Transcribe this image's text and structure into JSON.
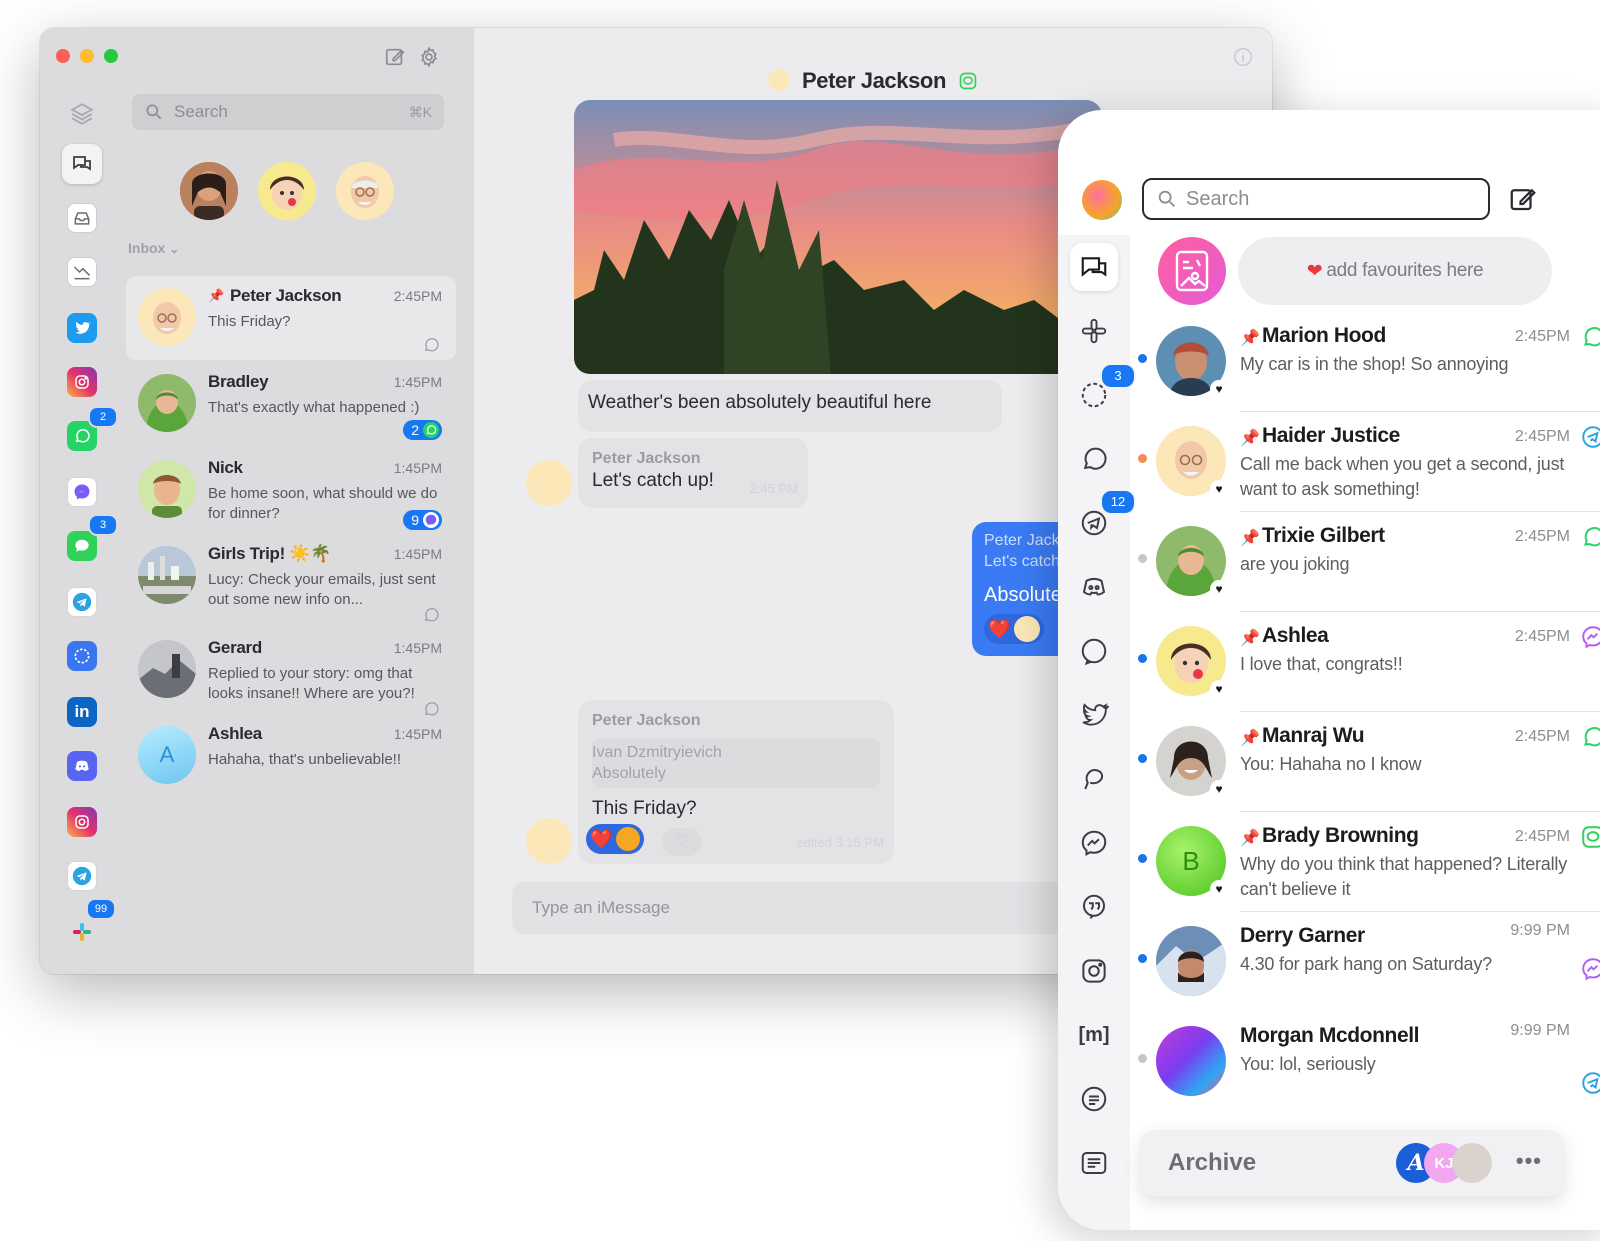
{
  "desktop": {
    "search": {
      "placeholder": "Search",
      "shortcut": "⌘K"
    },
    "inbox_label": "Inbox",
    "rail_badges": {
      "whatsapp": "2",
      "imessage": "3",
      "slack": "99"
    },
    "conversations": [
      {
        "name": "Peter Jackson",
        "time": "2:45PM",
        "preview": "This Friday?"
      },
      {
        "name": "Bradley",
        "time": "1:45PM",
        "preview": "That's exactly what happened :)",
        "badge": "2"
      },
      {
        "name": "Nick",
        "time": "1:45PM",
        "preview": "Be home soon, what should we do for dinner?",
        "badge": "9"
      },
      {
        "name": "Girls Trip! ☀️🌴",
        "time": "1:45PM",
        "preview": "Lucy: Check your emails, just sent out some new info on..."
      },
      {
        "name": "Gerard",
        "time": "1:45PM",
        "preview": "Replied to your story: omg that looks insane!! Where are you?!"
      },
      {
        "name": "Ashlea",
        "time": "1:45PM",
        "preview": "Hahaha, that's unbelievable!!",
        "initial": "A"
      }
    ],
    "chat": {
      "title": "Peter Jackson",
      "msg1": "Weather's been absolutely beautiful here",
      "msg2_sender": "Peter Jackson",
      "msg2_text": "Let's catch up!",
      "msg2_time": "2:45 PM",
      "out_quote_sender": "Peter Jackson",
      "out_quote_text": "Let's catch up!",
      "out_text": "Absolutely",
      "msg3_sender": "Peter Jackson",
      "msg3_quote_sender": "Ivan Dzmitryievich",
      "msg3_quote_text": "Absolutely",
      "msg3_text": "This Friday?",
      "msg3_time": "edited 3:15 PM",
      "composer_placeholder": "Type an  iMessage"
    }
  },
  "mobile": {
    "search_placeholder": "Search",
    "favourites_hint": "add favourites here",
    "rail_badges": {
      "signal": "3",
      "telegram": "12"
    },
    "conversations": [
      {
        "name": "Marion Hood",
        "time": "2:45PM",
        "preview": "My car is in the shop! So annoying",
        "network": "whatsapp",
        "dot": "#1a73e8"
      },
      {
        "name": "Haider Justice",
        "time": "2:45PM",
        "preview": "Call me back when you get a second, just want to ask something!",
        "network": "telegram",
        "dot": "#f28b54"
      },
      {
        "name": "Trixie Gilbert",
        "time": "2:45PM",
        "preview": "are you joking",
        "network": "whatsapp",
        "dot": "#c6c6ca"
      },
      {
        "name": "Ashlea",
        "time": "2:45PM",
        "preview": "I love that, congrats!!",
        "network": "messenger",
        "dot": "#1a73e8"
      },
      {
        "name": "Manraj Wu",
        "time": "2:45PM",
        "preview": "You: Hahaha no I know",
        "network": "whatsapp",
        "dot": "#1a73e8"
      },
      {
        "name": "Brady Browning",
        "time": "2:45PM",
        "preview": "Why do you think that happened? Literally can't believe it",
        "network": "imessage",
        "dot": "#1a73e8",
        "initial": "B"
      },
      {
        "name": "Derry Garner",
        "time": "9:99 PM",
        "preview": "4.30 for park hang on Saturday?",
        "network": "messenger",
        "dot": "#1a73e8"
      },
      {
        "name": "Morgan Mcdonnell",
        "time": "9:99 PM",
        "preview": "You: lol, seriously",
        "network": "telegram",
        "dot": "#c6c6ca"
      }
    ],
    "archive_label": "Archive",
    "archive_initials": "KJ"
  },
  "colors": {
    "accent": "#1877f2",
    "outgoing_bubble": "#3a7bf5",
    "whatsapp": "#25d366",
    "telegram": "#2aa3e0",
    "messenger": "#b55cf2"
  }
}
